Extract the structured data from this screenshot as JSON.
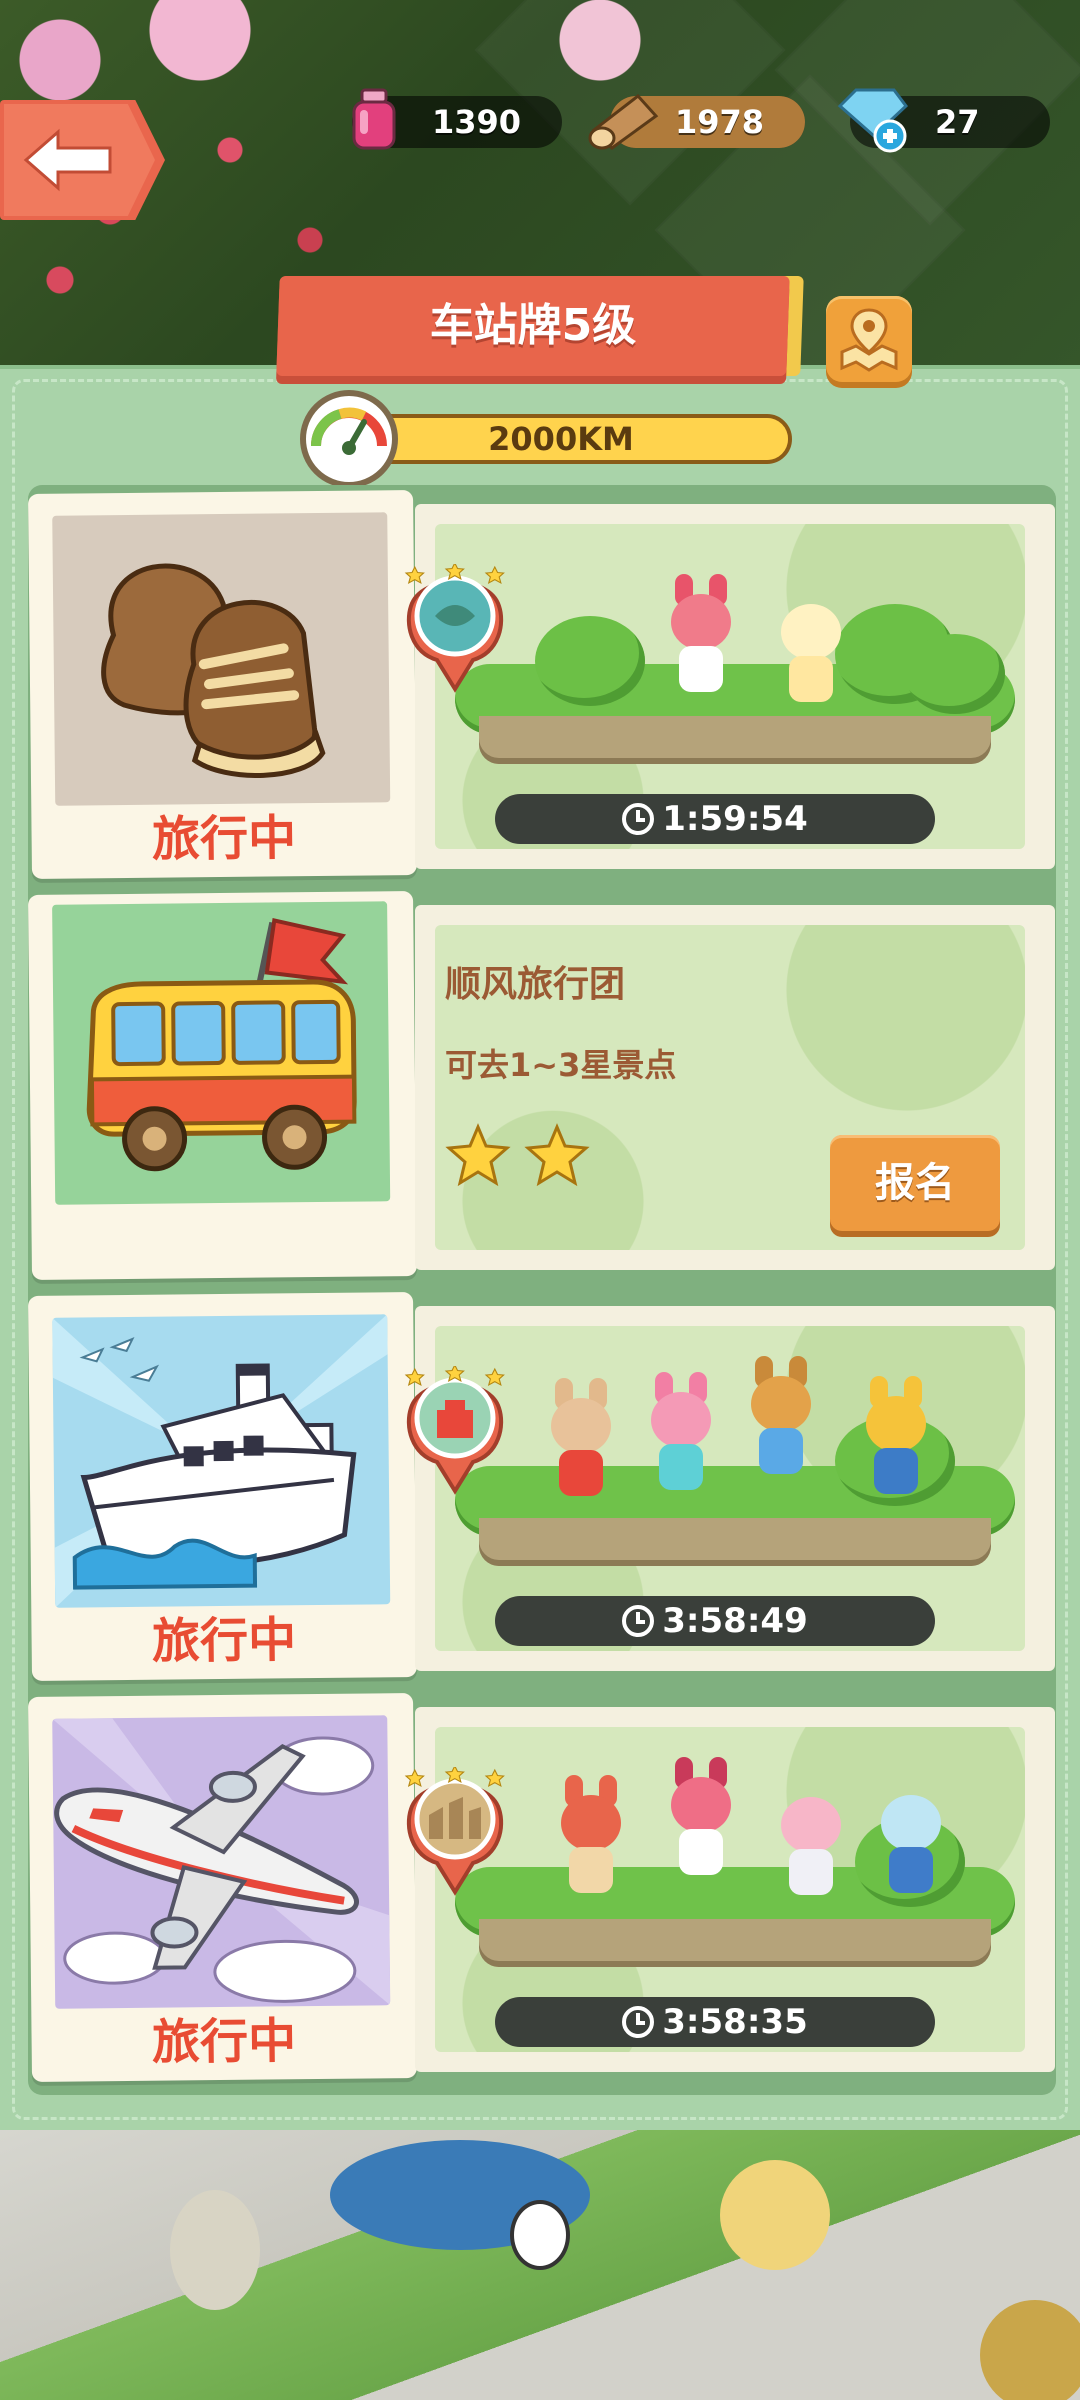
{
  "hud": {
    "potion": "1390",
    "wood": "1978",
    "gem": "27"
  },
  "panel": {
    "title": "车站牌5级",
    "distance": "2000KM"
  },
  "cards": [
    {
      "vehicle": "boots",
      "status": "旅行中",
      "timer": "1:59:54",
      "stars": 3
    },
    {
      "vehicle": "bus",
      "tour_name": "顺风旅行团",
      "tour_desc": "可去1~3星景点",
      "stars": 2,
      "button": "报名"
    },
    {
      "vehicle": "ship",
      "status": "旅行中",
      "timer": "3:58:49",
      "stars": 3
    },
    {
      "vehicle": "plane",
      "status": "旅行中",
      "timer": "3:58:35",
      "stars": 3
    }
  ],
  "colors": {
    "accent_red": "#e84c33",
    "banner": "#e8654b",
    "panel": "#a9d3a9",
    "button_orange": "#ee9a3f"
  }
}
